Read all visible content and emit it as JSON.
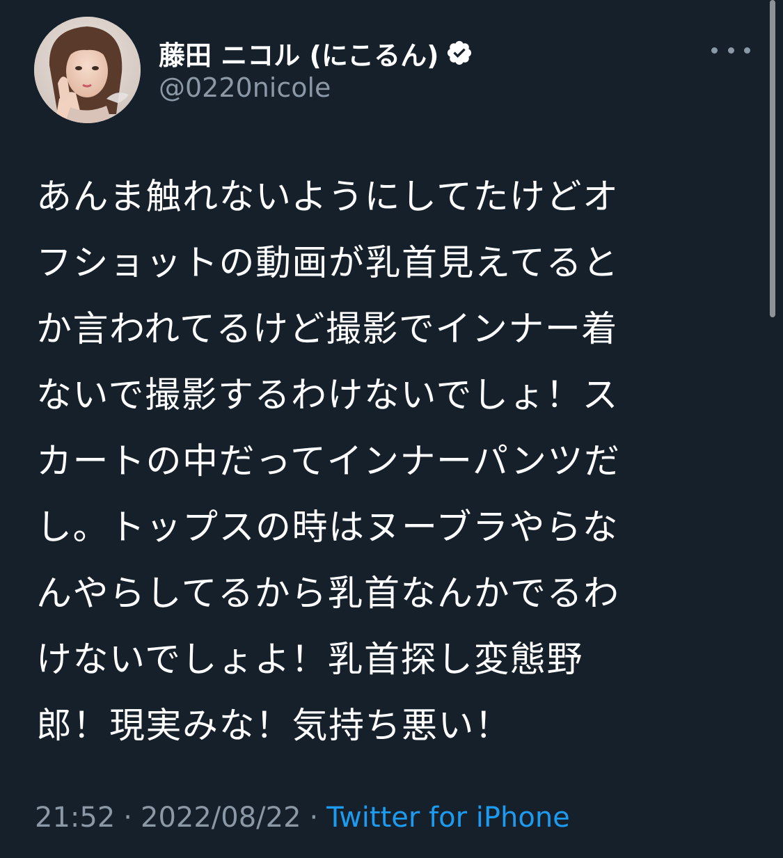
{
  "user": {
    "display_name": "藤田 ニコル (にこるん)",
    "handle": "@0220nicole",
    "verified": true,
    "avatar_icon": "profile-photo"
  },
  "menu": {
    "more_icon": "more-horizontal-icon"
  },
  "tweet": {
    "lines": [
      "あんま触れないようにしてたけどオ",
      "フショットの動画が乳首見えてると",
      "か言われてるけど撮影でインナー着",
      "ないで撮影するわけないでしょ！ス",
      "カートの中だってインナーパンツだ",
      "し。トップスの時はヌーブラやらな",
      "んやらしてるから乳首なんかでるわ",
      "けないでしょよ！乳首探し変態野",
      "郎！現実みな！気持ち悪い！"
    ]
  },
  "meta": {
    "time": "21:52",
    "separator": "·",
    "date": "2022/08/22",
    "source": "Twitter for iPhone"
  },
  "colors": {
    "background": "#15202b",
    "text_primary": "#ffffff",
    "text_secondary": "#8b98a5",
    "link": "#1d9bf0"
  }
}
